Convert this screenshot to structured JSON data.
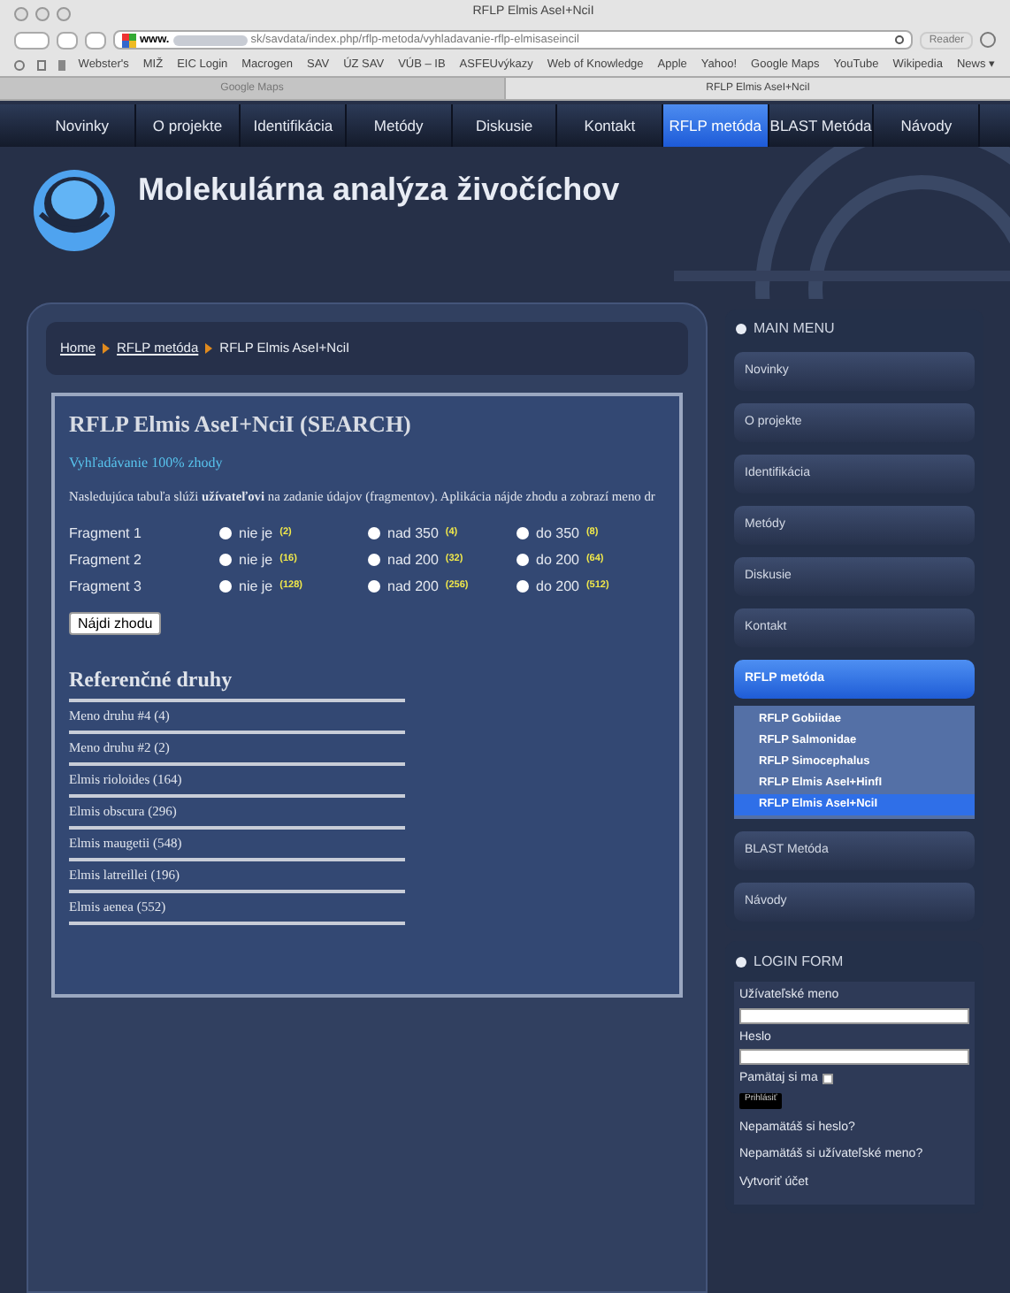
{
  "browser": {
    "title": "RFLP Elmis AseI+NciI",
    "url_prefix": "www.",
    "url_path": "sk/savdata/index.php/rflp-metoda/vyhladavanie-rflp-elmisaseincil",
    "reader": "Reader",
    "bookmarks": [
      "Webster's",
      "MIŽ",
      "EIC Login",
      "Macrogen",
      "SAV",
      "ÚZ SAV",
      "VÚB – IB",
      "ASFEUvýkazy",
      "Web of Knowledge",
      "Apple",
      "Yahoo!",
      "Google Maps",
      "YouTube",
      "Wikipedia",
      "News ▾"
    ],
    "tabs": [
      {
        "label": "Google Maps",
        "selected": false
      },
      {
        "label": "RFLP Elmis AseI+NciI",
        "selected": true
      }
    ]
  },
  "nav": [
    {
      "label": "Novinky",
      "selected": false
    },
    {
      "label": "O projekte",
      "selected": false
    },
    {
      "label": "Identifikácia",
      "selected": false
    },
    {
      "label": "Metódy",
      "selected": false
    },
    {
      "label": "Diskusie",
      "selected": false
    },
    {
      "label": "Kontakt",
      "selected": false
    },
    {
      "label": "RFLP metóda",
      "selected": true
    },
    {
      "label": "BLAST Metóda",
      "selected": false
    },
    {
      "label": "Návody",
      "selected": false
    }
  ],
  "site_title": "Molekulárna analýza živočíchov",
  "breadcrumb": [
    {
      "label": "Home",
      "current": false
    },
    {
      "label": "RFLP metóda",
      "current": false
    },
    {
      "label": "RFLP Elmis AseI+NciI",
      "current": true
    }
  ],
  "article": {
    "title": "RFLP Elmis AseI+NciI (SEARCH)",
    "subtitle": "Vyhľadávanie 100% zhody",
    "intro": "Nasledujúca tabuľa slúži **užívateľovi** na zadanie údajov (fragmentov). Aplikácia nájde zhodu a zobrazí meno dr",
    "fragments": [
      {
        "label": "Fragment 1",
        "options": [
          {
            "label": "nie je",
            "count": "(2)",
            "checked": false
          },
          {
            "label": "nad 350",
            "count": "(4)",
            "checked": false
          },
          {
            "label": "do 350",
            "count": "(8)",
            "checked": false
          }
        ]
      },
      {
        "label": "Fragment 2",
        "options": [
          {
            "label": "nie je",
            "count": "(16)",
            "checked": false
          },
          {
            "label": "nad 200",
            "count": "(32)",
            "checked": false
          },
          {
            "label": "do 200",
            "count": "(64)",
            "checked": false
          }
        ]
      },
      {
        "label": "Fragment 3",
        "options": [
          {
            "label": "nie je",
            "count": "(128)",
            "checked": false
          },
          {
            "label": "nad 200",
            "count": "(256)",
            "checked": false
          },
          {
            "label": "do 200",
            "count": "(512)",
            "checked": false
          }
        ]
      }
    ],
    "button": "Nájdi zhodu",
    "ref_title": "Referenčné druhy",
    "species": [
      "Meno druhu #4 (4)",
      "Meno druhu #2 (2)",
      "Elmis rioloides (164)",
      "Elmis obscura (296)",
      "Elmis maugetii (548)",
      "Elmis latreillei (196)",
      "Elmis aenea (552)"
    ]
  },
  "main_menu": {
    "title": "MAIN MENU",
    "items": [
      {
        "label": "Novinky",
        "selected": false
      },
      {
        "label": "O projekte",
        "selected": false
      },
      {
        "label": "Identifikácia",
        "selected": false
      },
      {
        "label": "Metódy",
        "selected": false
      },
      {
        "label": "Diskusie",
        "selected": false
      },
      {
        "label": "Kontakt",
        "selected": false
      },
      {
        "label": "RFLP metóda",
        "selected": true,
        "children": [
          {
            "label": "RFLP Gobiidae",
            "selected": false
          },
          {
            "label": "RFLP Salmonidae",
            "selected": false
          },
          {
            "label": "RFLP Simocephalus",
            "selected": false
          },
          {
            "label": "RFLP Elmis AseI+HinfI",
            "selected": false
          },
          {
            "label": "RFLP Elmis AseI+NciI",
            "selected": true
          }
        ]
      },
      {
        "label": "BLAST Metóda",
        "selected": false
      },
      {
        "label": "Návody",
        "selected": false
      }
    ]
  },
  "login": {
    "title": "LOGIN FORM",
    "username_label": "Užívateľské meno",
    "password_label": "Heslo",
    "remember_label": "Pamätaj si ma",
    "remember_checked": false,
    "submit": "Prihlásiť",
    "links": [
      "Nepamätáš si heslo?",
      "Nepamätáš si užívateľské meno?",
      "Vytvoriť účet"
    ]
  }
}
